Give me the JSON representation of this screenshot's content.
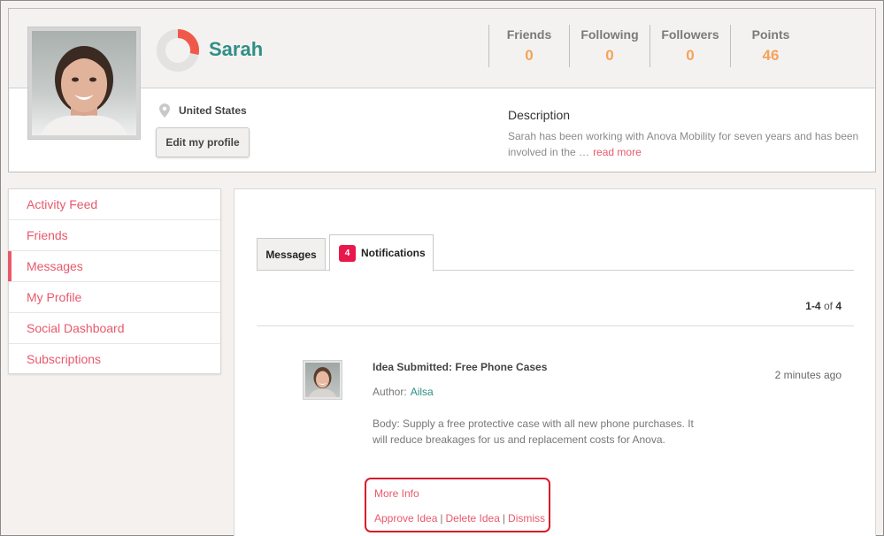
{
  "profile": {
    "name": "Sarah",
    "location": "United States",
    "edit_button": "Edit my profile",
    "description_title": "Description",
    "description_text": "Sarah has been working with Anova Mobility for seven years and has been involved in the …",
    "read_more": "read more",
    "stats": [
      {
        "label": "Friends",
        "value": "0"
      },
      {
        "label": "Following",
        "value": "0"
      },
      {
        "label": "Followers",
        "value": "0"
      },
      {
        "label": "Points",
        "value": "46"
      }
    ],
    "colors": {
      "accent": "#e8596b",
      "name": "#2f8f86",
      "stat_value": "#f4a35a"
    }
  },
  "sidebar": {
    "items": [
      {
        "label": "Activity Feed",
        "active": false
      },
      {
        "label": "Friends",
        "active": false
      },
      {
        "label": "Messages",
        "active": true
      },
      {
        "label": "My Profile",
        "active": false
      },
      {
        "label": "Social Dashboard",
        "active": false
      },
      {
        "label": "Subscriptions",
        "active": false
      }
    ]
  },
  "tabs": {
    "messages": "Messages",
    "notifications": "Notifications",
    "notifications_badge": "4"
  },
  "pager": {
    "range": "1-4",
    "of": "of",
    "total": "4"
  },
  "notification": {
    "title": "Idea Submitted: Free Phone Cases",
    "time": "2 minutes ago",
    "author_label": "Author:",
    "author_name": "Ailsa",
    "body": "Body:  Supply a free protective case with all new phone purchases. It will reduce breakages for us and replacement costs for Anova.",
    "more_info": "More Info",
    "approve": "Approve Idea",
    "delete": "Delete Idea",
    "dismiss": "Dismiss",
    "separator": "|"
  }
}
